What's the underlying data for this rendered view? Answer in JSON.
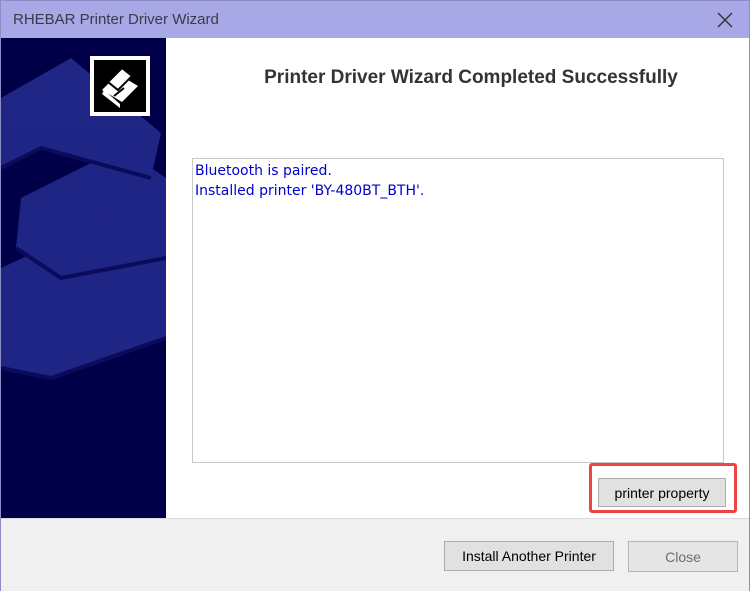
{
  "window": {
    "title": "RHEBAR Printer Driver Wizard"
  },
  "main": {
    "heading": "Printer Driver Wizard Completed Successfully",
    "log_lines": [
      "Bluetooth is paired.",
      "Installed printer 'BY-480BT_BTH'."
    ],
    "property_button": "printer property"
  },
  "footer": {
    "install_another_label": "Install Another Printer",
    "close_label": "Close"
  },
  "colors": {
    "titlebar": "#a8a8e6",
    "banner": "#000049",
    "log_text": "#0000cc",
    "highlight": "#ee4444"
  },
  "icons": [
    "close-icon",
    "printer-logo-icon"
  ]
}
